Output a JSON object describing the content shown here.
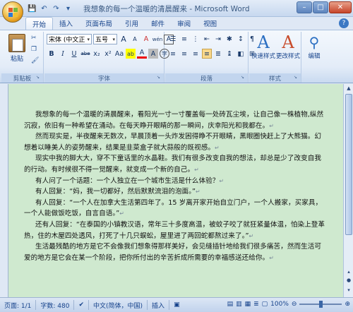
{
  "window": {
    "title": "我想象的每一个温暖的清晨醒来 - Microsoft Word",
    "controls": {
      "minimize": "–",
      "maximize": "□",
      "close": "✕"
    }
  },
  "qat": [
    "save-icon",
    "undo-icon",
    "redo-icon",
    "more-icon"
  ],
  "tabs": [
    "开始",
    "插入",
    "页面布局",
    "引用",
    "邮件",
    "审阅",
    "视图"
  ],
  "active_tab": "开始",
  "ribbon": {
    "clipboard": {
      "paste_label": "粘贴",
      "group_label": "剪贴板"
    },
    "font": {
      "font_name": "宋体 (中文正",
      "font_size": "五号",
      "bigger": "A",
      "smaller": "A",
      "clear": "A",
      "wen": "wén",
      "char_border": "A",
      "bold": "B",
      "italic": "I",
      "underline": "U",
      "strike": "abe",
      "sub": "x₂",
      "sup": "x²",
      "change_case": "Aa",
      "highlight": "ab",
      "font_color": "A",
      "char_shade": "A",
      "circle": "字",
      "group_label": "字体"
    },
    "paragraph": {
      "group_label": "段落"
    },
    "styles": {
      "quick_styles": "快速样式",
      "change_styles": "更改样式",
      "group_label": "样式"
    },
    "editing": {
      "label": "编辑"
    }
  },
  "document": {
    "paragraphs": [
      "我想象的每一个温暖的清晨醒来，看阳光一寸一寸覆盖每一处砖瓦尘埃，让自己像一株植物,纵然沉寂，依旧有一种希望在涌动。在每天睁开眼睛的那一瞬间，庆幸阳光和我都在。",
      "然而现实是，半夜醒来无数次，早晨顶着一头炸发困得睁不开眼睛，黑眼圈快赶上了大熊猫。幻想着以睡美人的姿势醒来，结果是韭菜盒子就大蒜般的既视感。",
      "现实中我的脚大大，穿不下童话里的水晶鞋。我们有很多改变自我的想法，却总是少了改变自我的行动。有时候很不得一觉醒来，就变成一个新的自己。",
      "有人问了一个话题：一个人独立在一个城市生活是什么体验？",
      "有人回复：“妈，我一切都好，然后默默流泪的泡面。”",
      "有人回复：“一个人在加拿大生活第四年了。15 岁离开家开始自立门户，一个人搬家，买家具，一个人能做饭吃饭，自言自语。”",
      "还有人回复：“在泰国的小镇教汉语，常年三十多度高温，被蚊子咬了就狂紧量体温，怕染上登革热，住的木屋四处透风，打死了十几只蜈蚣，屋里进了两回蛇都熬过来了。”",
      "生活最残酷的地方是它不会像我们想象得那样美好，会见缝插针地给我们很多痛苦，然而生活可爱的地方是它会在某一个阶段，把你所付出的辛苦折成所需要的幸福感送还给你。"
    ]
  },
  "status": {
    "page": "页面: 1/1",
    "words": "字数: 480",
    "language": "中文(简体，中国)",
    "mode": "插入",
    "zoom": "100%",
    "zoom_level": 0.5
  }
}
